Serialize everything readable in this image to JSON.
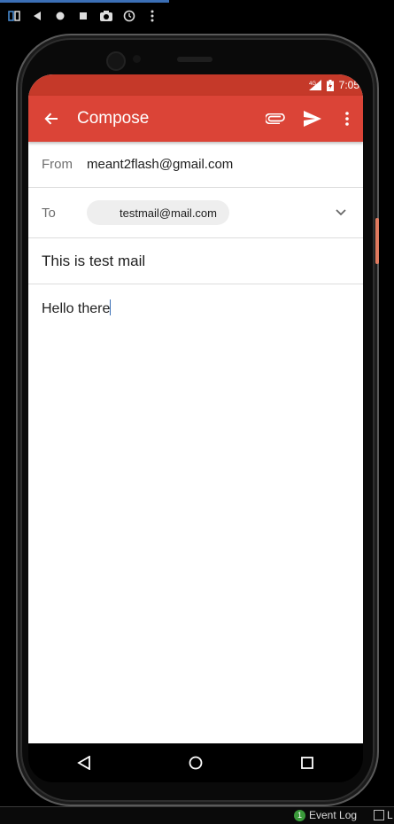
{
  "emulator": {
    "icons": [
      "rotate-icon",
      "back-icon",
      "home-icon",
      "overview-icon",
      "camera-icon",
      "history-icon",
      "more-vert-icon"
    ]
  },
  "statusbar": {
    "network": "4G",
    "time": "7:05"
  },
  "appbar": {
    "title": "Compose",
    "color": "#db4437",
    "status_color": "#c53929"
  },
  "form": {
    "from_label": "From",
    "from_value": "meant2flash@gmail.com",
    "to_label": "To",
    "to_chip": "testmail@mail.com",
    "subject": "This is test mail",
    "body": "Hello there"
  },
  "ide": {
    "event_badge": "1",
    "event_log": "Event Log",
    "extra": "L"
  }
}
